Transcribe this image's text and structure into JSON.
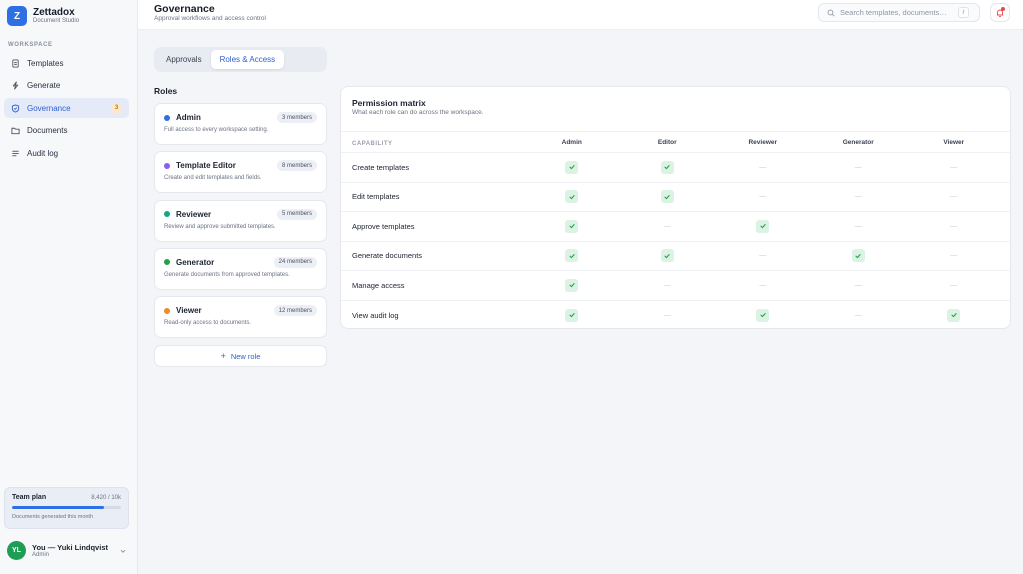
{
  "brand": {
    "name": "Zettadox",
    "subtitle": "Document Studio",
    "logo_letter": "Z",
    "accent": "#2f6fe4"
  },
  "sidebar": {
    "section_label": "WORKSPACE",
    "items": [
      {
        "label": "Templates",
        "icon": "document-icon",
        "active": false
      },
      {
        "label": "Generate",
        "icon": "bolt-icon",
        "active": false
      },
      {
        "label": "Governance",
        "icon": "shield-icon",
        "active": true,
        "badge": "3"
      },
      {
        "label": "Documents",
        "icon": "folder-icon",
        "active": false
      },
      {
        "label": "Audit log",
        "icon": "list-icon",
        "active": false
      }
    ],
    "plan": {
      "title": "Team plan",
      "usage": "8,420 / 10k",
      "progress": 0.842,
      "caption": "Documents generated this month"
    },
    "user": {
      "initials": "YL",
      "name": "You — Yuki Lindqvist",
      "role": "Admin"
    }
  },
  "header": {
    "title": "Governance",
    "subtitle": "Approval workflows and access control",
    "search_placeholder": "Search templates, documents…",
    "search_shortcut": "/"
  },
  "tabs": [
    {
      "label": "Approvals",
      "active": false
    },
    {
      "label": "Roles & Access",
      "active": true
    }
  ],
  "roles": {
    "title": "Roles",
    "items": [
      {
        "name": "Admin",
        "members": "3 members",
        "description": "Full access to every workspace setting.",
        "color": "#2f6fe4"
      },
      {
        "name": "Template Editor",
        "members": "8 members",
        "description": "Create and edit templates and fields.",
        "color": "#8b5cf6"
      },
      {
        "name": "Reviewer",
        "members": "5 members",
        "description": "Review and approve submitted templates.",
        "color": "#14a38b"
      },
      {
        "name": "Generator",
        "members": "24 members",
        "description": "Generate documents from approved templates.",
        "color": "#22a04b"
      },
      {
        "name": "Viewer",
        "members": "12 members",
        "description": "Read-only access to documents.",
        "color": "#f08a24"
      }
    ],
    "new_role_label": "New role"
  },
  "matrix": {
    "title": "Permission matrix",
    "subtitle": "What each role can do across the workspace.",
    "capability_header": "CAPABILITY",
    "role_headers": [
      "Admin",
      "Editor",
      "Reviewer",
      "Generator",
      "Viewer"
    ],
    "rows": [
      {
        "capability": "Create templates",
        "access": [
          true,
          true,
          false,
          false,
          false
        ]
      },
      {
        "capability": "Edit templates",
        "access": [
          true,
          true,
          false,
          false,
          false
        ]
      },
      {
        "capability": "Approve templates",
        "access": [
          true,
          false,
          true,
          false,
          false
        ]
      },
      {
        "capability": "Generate documents",
        "access": [
          true,
          true,
          false,
          true,
          false
        ]
      },
      {
        "capability": "Manage access",
        "access": [
          true,
          false,
          false,
          false,
          false
        ]
      },
      {
        "capability": "View audit log",
        "access": [
          true,
          false,
          true,
          false,
          true
        ]
      }
    ],
    "no_access_symbol": "—"
  }
}
